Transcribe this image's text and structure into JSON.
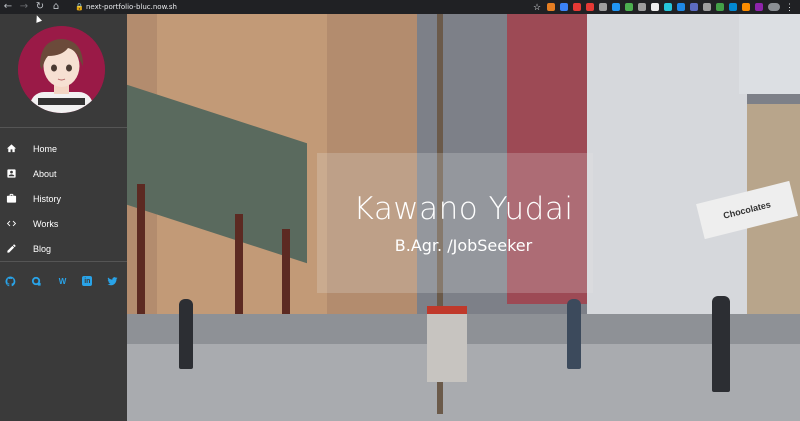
{
  "browser": {
    "url": "next-portfolio-bluc.now.sh",
    "back_icon": "arrow-left",
    "forward_icon": "arrow-right",
    "reload_icon": "reload",
    "home_icon": "home"
  },
  "sidebar": {
    "avatar_alt": "avatar",
    "menu": [
      {
        "label": "Home",
        "icon": "home-icon"
      },
      {
        "label": "About",
        "icon": "contact-card-icon"
      },
      {
        "label": "History",
        "icon": "briefcase-icon"
      },
      {
        "label": "Works",
        "icon": "code-icon"
      },
      {
        "label": "Blog",
        "icon": "pencil-icon"
      }
    ],
    "social": [
      {
        "icon": "github-icon"
      },
      {
        "icon": "qiita-icon"
      },
      {
        "icon": "wantedly-icon",
        "text": "W"
      },
      {
        "icon": "linkedin-icon",
        "text": "in"
      },
      {
        "icon": "twitter-icon"
      }
    ]
  },
  "hero": {
    "title": "Kawano Yudai",
    "subtitle": "B.Agr. /JobSeeker",
    "sign_text": "Chocolates"
  },
  "colors": {
    "sidebar_bg": "#3a3a3a",
    "avatar_bg": "#9a1a47",
    "social_accent": "#29a3e8",
    "browser_bg": "#202124"
  }
}
